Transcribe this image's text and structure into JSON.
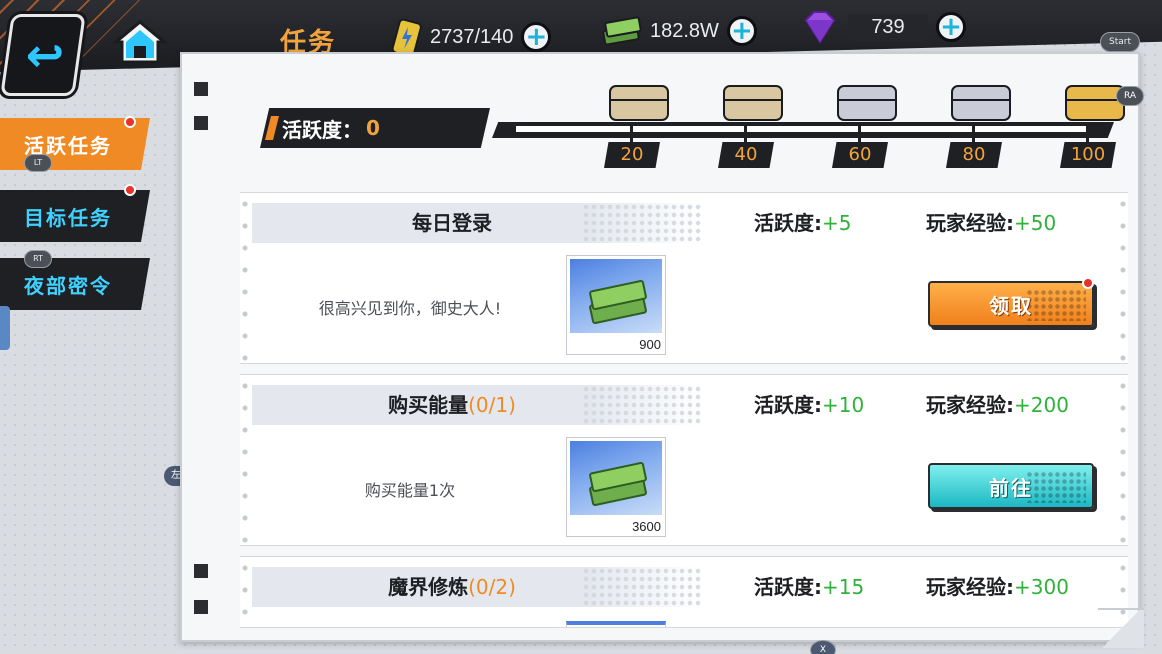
{
  "header": {
    "title": "任务",
    "energy": "2737/140",
    "money": "182.8W",
    "gems": "739",
    "start_label": "Start"
  },
  "tabs": [
    {
      "label": "活跃任务",
      "badge": "LT",
      "active": true
    },
    {
      "label": "目标任务",
      "active": false
    },
    {
      "label": "夜部密令",
      "badge": "RT",
      "active": false
    }
  ],
  "left_stick_label": "左摇杆",
  "activity": {
    "label": "活跃度：",
    "value": "0",
    "milestones": [
      "20",
      "40",
      "60",
      "80",
      "100"
    ],
    "ra_badge": "RA"
  },
  "tasks": [
    {
      "title": "每日登录",
      "progress": "",
      "activity_label": "活跃度:",
      "activity_gain": "+5",
      "exp_label": "玩家经验:",
      "exp_gain": "+50",
      "description": "很高兴见到你，御史大人!",
      "reward_qty": "900",
      "button": "领取"
    },
    {
      "title": "购买能量",
      "progress": "(0/1)",
      "activity_label": "活跃度:",
      "activity_gain": "+10",
      "exp_label": "玩家经验:",
      "exp_gain": "+200",
      "description": "购买能量1次",
      "reward_qty": "3600",
      "button": "前往"
    },
    {
      "title": "魔界修炼",
      "progress": "(0/2)",
      "activity_label": "活跃度:",
      "activity_gain": "+15",
      "exp_label": "玩家经验:",
      "exp_gain": "+300"
    }
  ],
  "bottom_badge": "X",
  "colors": {
    "accent_orange": "#f08a24",
    "accent_cyan": "#3fd1ff",
    "gain_green": "#2fb23a"
  },
  "icons": [
    "back-arrow-icon",
    "home-icon",
    "energy-can-icon",
    "cash-stack-icon",
    "diamond-icon",
    "plus-icon",
    "chest-icon"
  ]
}
